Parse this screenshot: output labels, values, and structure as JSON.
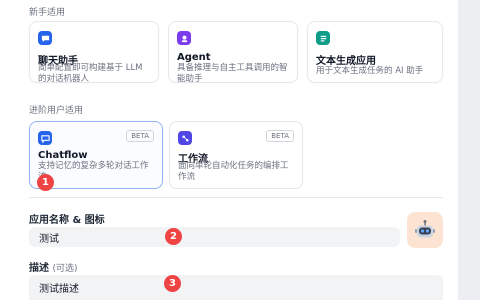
{
  "sections": {
    "beginner_label": "新手适用",
    "advanced_label": "进阶用户适用"
  },
  "cards_beginner": [
    {
      "title": "聊天助手",
      "desc": "简单配置即可构建基于 LLM 的对话机器人",
      "icon": "chat-bubble-icon",
      "color": "#2563eb"
    },
    {
      "title": "Agent",
      "desc": "具备推理与自主工具调用的智能助手",
      "icon": "agent-icon",
      "color": "#7c3aed"
    },
    {
      "title": "文本生成应用",
      "desc": "用于文本生成任务的 AI 助手",
      "icon": "text-generation-icon",
      "color": "#0f9d8a"
    }
  ],
  "cards_advanced": [
    {
      "title": "Chatflow",
      "desc": "支持记忆的复杂多轮对话工作流",
      "badge": "BETA",
      "icon": "chatflow-icon",
      "color": "#2563eb"
    },
    {
      "title": "工作流",
      "desc": "面向单轮自动化任务的编排工作流",
      "badge": "BETA",
      "icon": "workflow-icon",
      "color": "#4f46e5"
    }
  ],
  "form": {
    "name_label": "应用名称 & 图标",
    "name_value": "测试",
    "desc_label": "描述",
    "desc_optional": "(可选)",
    "desc_value": "测试描述"
  },
  "markers": [
    "1",
    "2",
    "3"
  ],
  "avatar": {
    "icon": "robot-icon",
    "background": "#fde4d2"
  }
}
